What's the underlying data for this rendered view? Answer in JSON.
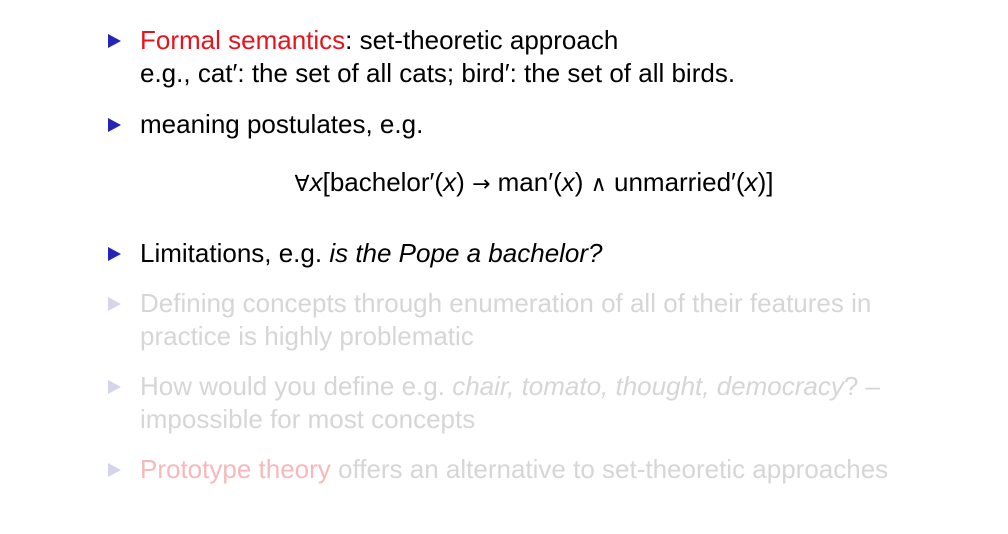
{
  "items": [
    {
      "lead": "Formal semantics",
      "rest": ": set-theoretic approach",
      "line2": "e.g., cat′: the set of all cats; bird′: the set of all birds."
    },
    {
      "text": "meaning postulates, e.g."
    },
    {
      "text": "Limitations, e.g. ",
      "emph": "is the Pope a bachelor?"
    },
    {
      "text": "Defining concepts through enumeration of all of their features in practice is highly problematic"
    },
    {
      "pre": "How would you define e.g. ",
      "emph": "chair, tomato, thought, democracy",
      "post": "? – impossible for most concepts"
    },
    {
      "lead": "Prototype theory",
      "rest": " offers an alternative to set-theoretic approaches"
    }
  ],
  "formula": {
    "forall": "∀",
    "var_x": "x",
    "bachelor": "[bachelor′(",
    "close1": ") ",
    "arrow": "→",
    "man": " man′(",
    "close2": ") ",
    "and": "∧",
    "unmarried": " unmarried′(",
    "close3": ")]"
  },
  "colors": {
    "bullet": "#2424b8",
    "highlight": "#e8131b",
    "faded_text": "#d6d6d6"
  }
}
